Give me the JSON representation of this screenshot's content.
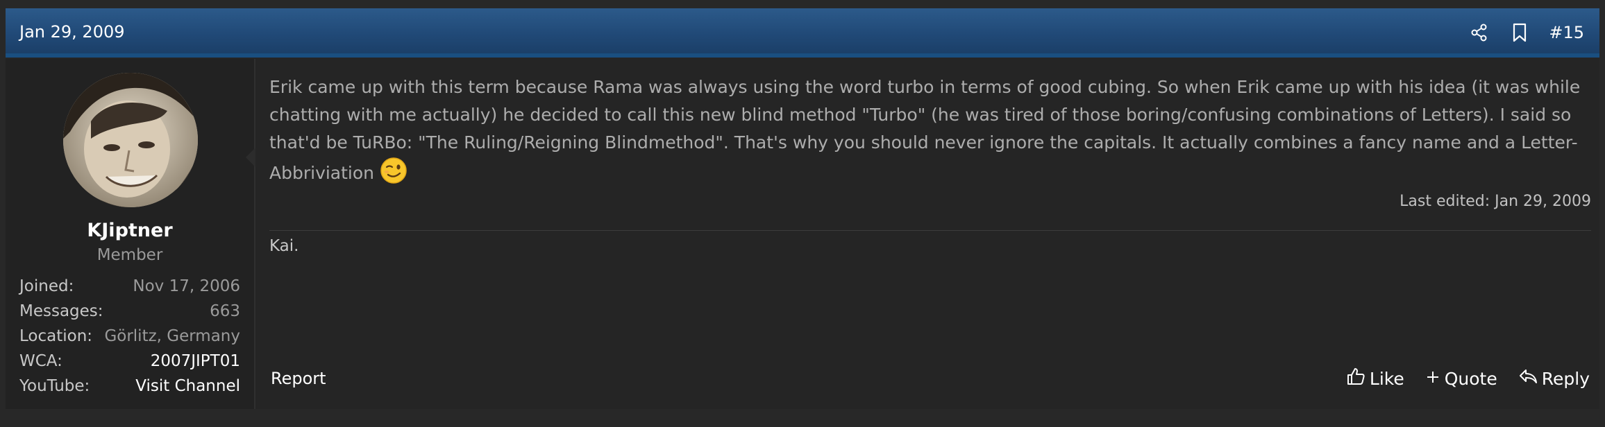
{
  "post": {
    "date": "Jan 29, 2009",
    "number": "#15",
    "icons": {
      "share": "share-icon",
      "bookmark": "bookmark-icon"
    }
  },
  "user": {
    "name": "KJiptner",
    "title": "Member",
    "stats": [
      {
        "label": "Joined:",
        "value": "Nov 17, 2006"
      },
      {
        "label": "Messages:",
        "value": "663"
      },
      {
        "label": "Location:",
        "value": "Görlitz, Germany"
      },
      {
        "label": "WCA:",
        "value": "2007JIPT01"
      },
      {
        "label": "YouTube:",
        "value": "Visit Channel"
      }
    ]
  },
  "message": {
    "text": "Erik came up with this term because Rama was always using the word turbo in terms of good cubing. So when Erik came up with his idea (it was while chatting with me actually) he decided to call this new blind method \"Turbo\" (he was tired of those boring/confusing combinations of Letters). I said so that'd be TuRBo: \"The Ruling/Reigning Blindmethod\". That's why you should never ignore the capitals. It actually combines a fancy name and a Letter-Abbriviation ",
    "emoji": "winking-face-emoji"
  },
  "last_edited": "Last edited: Jan 29, 2009",
  "signature": "Kai.",
  "footer": {
    "report": "Report",
    "like": "Like",
    "quote": "Quote",
    "reply": "Reply"
  },
  "colors": {
    "header_top": "#2c5a8a",
    "header_bottom": "#1b3f68",
    "background": "#252525",
    "text_muted": "#adadad"
  }
}
